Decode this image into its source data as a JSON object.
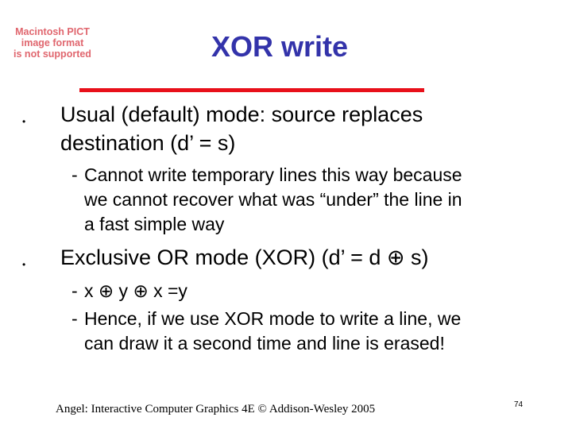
{
  "placeholder_image": {
    "lines": [
      "Macintosh PICT",
      "image format",
      "is not supported"
    ],
    "color": "#e0666e"
  },
  "slide": {
    "title": "XOR write",
    "title_color": "#3333aa",
    "rule_color": "#e8101a",
    "bullets": [
      {
        "marker": "•",
        "lines": [
          "Usual (default) mode: source replaces",
          "destination (d’ = s)"
        ],
        "subitems": [
          {
            "marker": "-",
            "lines": [
              "Cannot write temporary lines this way because",
              "we cannot recover what was “under” the line in",
              "a fast simple way"
            ]
          }
        ]
      },
      {
        "marker": "•",
        "lines": [
          "Exclusive OR mode (XOR) (d’ = d ⊕ s)"
        ],
        "subitems": [
          {
            "marker": "-",
            "lines": [
              "x ⊕ y ⊕ x =y"
            ]
          },
          {
            "marker": "-",
            "lines": [
              "Hence, if we use XOR mode to write a line, we",
              "can draw it a second time and line is erased!"
            ]
          }
        ]
      }
    ]
  },
  "footer": {
    "citation": "Angel: Interactive Computer Graphics 4E © Addison-Wesley 2005",
    "page_number": "74"
  }
}
